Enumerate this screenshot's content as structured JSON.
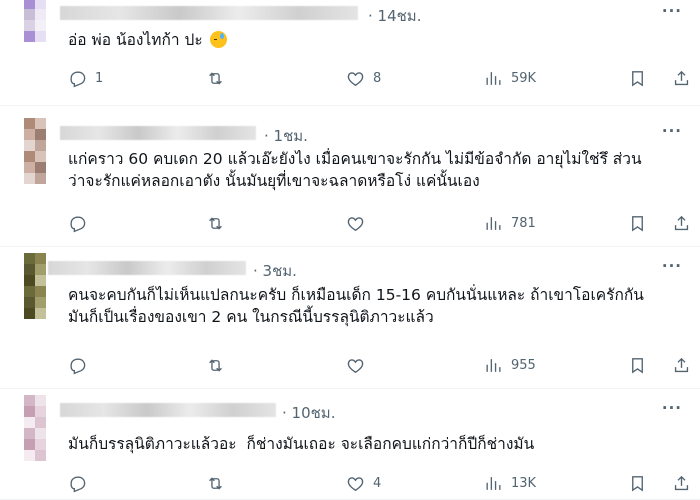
{
  "posts": [
    {
      "time": "· 14ชม.",
      "text": "อ่อ พ่อ น้องไทก้า ปะ",
      "emoji": "sweat-smile-emoji",
      "replies": "1",
      "retweets": "",
      "likes": "8",
      "views": "59K",
      "avatar_colors": [
        "#a98fd4",
        "#e6dff3",
        "#c8bfd6",
        "#efeaf5",
        "#d9d2e4",
        "#f3f0f7"
      ]
    },
    {
      "time": "· 1ชม.",
      "text": "แก่คราว 60 คบเดก 20 แล้วเอ๊ะยังไง เมื่อคนเขาจะรักกัน ไม่มีข้อจำกัด อายุไม่ใช่รึ ส่วน\nว่าจะรักแค่หลอกเอาตัง นั้นมันยุที่เขาจะฉลาดหรือโง่ แค่นั้นเอง",
      "replies": "",
      "retweets": "",
      "likes": "",
      "views": "781",
      "avatar_colors": [
        "#b08a78",
        "#d9c2b8",
        "#cdb0a3",
        "#9c7d72",
        "#e3d6d0",
        "#bfa59a"
      ]
    },
    {
      "time": "· 3ชม.",
      "text": "คนจะคบกันก็ไม่เห็นแปลกนะครับ ก็เหมือนเด็ก 15-16 คบกันนั่นแหละ ถ้าเขาโอเครักกัน\nมันก็เป็นเรื่องของเขา 2 คน ในกรณีนี้บรรลุนิติภาวะแล้ว",
      "replies": "",
      "retweets": "",
      "likes": "",
      "views": "955",
      "avatar_colors": [
        "#6b6a3a",
        "#8a8550",
        "#5a5830",
        "#a29e6c",
        "#4d4a22",
        "#c4c09a"
      ]
    },
    {
      "time": "· 10ชม.",
      "text": "มันก็บรรลุนิติภาวะแล้วอะ  ก็ช่างมันเถอะ จะเลือกคบแก่กว่าก็ปีก็ช่างมัน",
      "replies": "",
      "retweets": "",
      "likes": "4",
      "views": "13K",
      "avatar_colors": [
        "#d4b7c6",
        "#efe3ea",
        "#c79fb3",
        "#e6d3dd",
        "#f4ecf0",
        "#dcc5d1"
      ]
    }
  ],
  "icons": {
    "more": "more-icon",
    "reply": "reply-icon",
    "retweet": "retweet-icon",
    "like": "heart-icon",
    "views": "views-icon",
    "bookmark": "bookmark-icon",
    "share": "share-icon"
  },
  "more_glyph": "···"
}
